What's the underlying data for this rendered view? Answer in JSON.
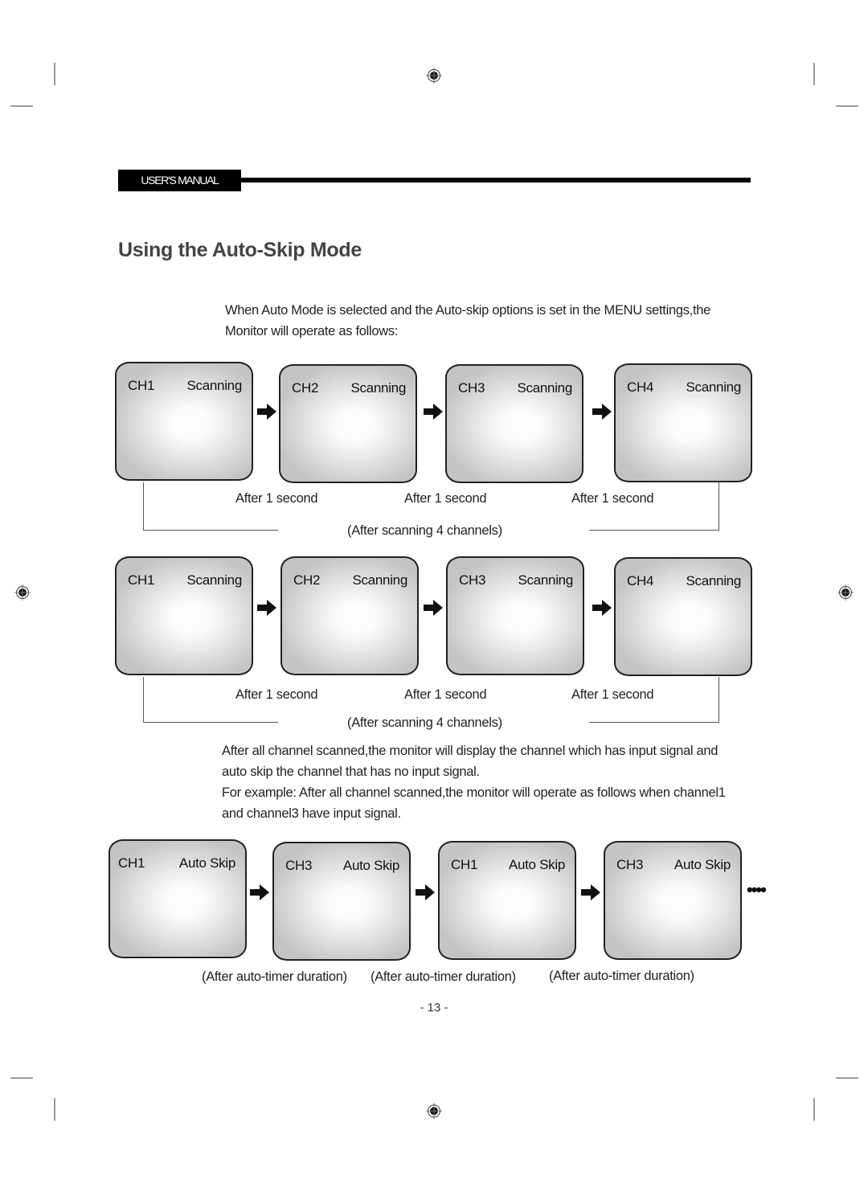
{
  "header": {
    "label": "USER'S MANUAL"
  },
  "title": "Using the Auto-Skip Mode",
  "intro": {
    "line1": "When Auto Mode is selected and the Auto-skip options is set in the MENU settings,the",
    "line2": "Monitor will operate as follows:"
  },
  "row1": {
    "monitors": [
      {
        "channel": "CH1",
        "status": "Scanning"
      },
      {
        "channel": "CH2",
        "status": "Scanning"
      },
      {
        "channel": "CH3",
        "status": "Scanning"
      },
      {
        "channel": "CH4",
        "status": "Scanning"
      }
    ],
    "captions": [
      "After 1 second",
      "After 1 second",
      "After 1 second"
    ],
    "loop_caption": "(After scanning 4 channels)"
  },
  "row2": {
    "monitors": [
      {
        "channel": "CH1",
        "status": "Scanning"
      },
      {
        "channel": "CH2",
        "status": "Scanning"
      },
      {
        "channel": "CH3",
        "status": "Scanning"
      },
      {
        "channel": "CH4",
        "status": "Scanning"
      }
    ],
    "captions": [
      "After 1 second",
      "After 1 second",
      "After 1 second"
    ],
    "loop_caption": "(After scanning 4 channels)"
  },
  "explanation": {
    "line1": "After all channel scanned,the monitor will display the channel which has input signal and",
    "line2": "auto skip the channel that has no input signal.",
    "line3": "For example: After all channel scanned,the monitor will operate as follows when channel1",
    "line4": "and channel3 have input signal."
  },
  "row3": {
    "monitors": [
      {
        "channel": "CH1",
        "status": "Auto Skip"
      },
      {
        "channel": "CH3",
        "status": "Auto Skip"
      },
      {
        "channel": "CH1",
        "status": "Auto Skip"
      },
      {
        "channel": "CH3",
        "status": "Auto Skip"
      }
    ],
    "captions": [
      "(After auto-timer duration)",
      "(After auto-timer duration)",
      "(After auto-timer duration)"
    ],
    "continuation": "••••"
  },
  "page_number": "- 13 -",
  "icons": {
    "arrow": "right-arrow-icon",
    "registration": "registration-mark-icon"
  }
}
